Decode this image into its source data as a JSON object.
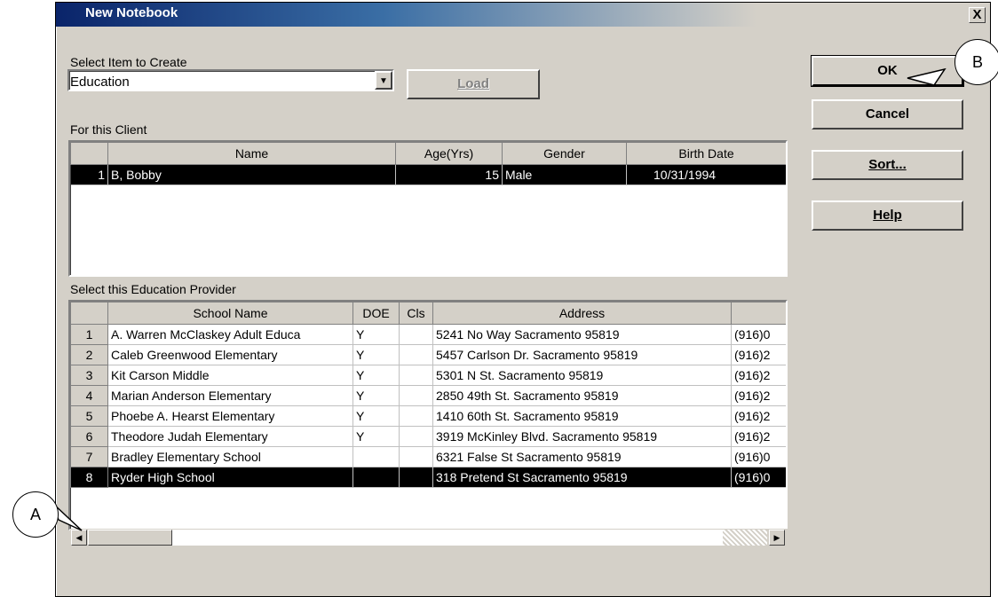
{
  "window": {
    "title": "New Notebook",
    "close_glyph": "X"
  },
  "select_item": {
    "label": "Select Item to Create",
    "value": "Education",
    "load_button": "Load"
  },
  "buttons": {
    "ok": "OK",
    "cancel": "Cancel",
    "sort": "Sort...",
    "help": "Help"
  },
  "client": {
    "label": "For this Client",
    "columns": [
      "Name",
      "Age(Yrs)",
      "Gender",
      "Birth Date"
    ],
    "rows": [
      {
        "num": "1",
        "name": "B, Bobby",
        "age": "15",
        "gender": "Male",
        "birth": "10/31/1994"
      }
    ]
  },
  "provider": {
    "label": "Select this Education Provider",
    "columns": [
      "School Name",
      "DOE",
      "Cls",
      "Address",
      ""
    ],
    "rows": [
      {
        "num": "1",
        "school": "A. Warren McClaskey Adult Educa",
        "doe": "Y",
        "cls": "",
        "address": "5241 No Way Sacramento 95819",
        "phone": "(916)0"
      },
      {
        "num": "2",
        "school": "Caleb Greenwood Elementary",
        "doe": "Y",
        "cls": "",
        "address": "5457 Carlson Dr. Sacramento 95819",
        "phone": "(916)2"
      },
      {
        "num": "3",
        "school": "Kit Carson Middle",
        "doe": "Y",
        "cls": "",
        "address": "5301 N St. Sacramento 95819",
        "phone": "(916)2"
      },
      {
        "num": "4",
        "school": "Marian Anderson Elementary",
        "doe": "Y",
        "cls": "",
        "address": "2850 49th St. Sacramento 95819",
        "phone": "(916)2"
      },
      {
        "num": "5",
        "school": "Phoebe A. Hearst Elementary",
        "doe": "Y",
        "cls": "",
        "address": "1410 60th St. Sacramento 95819",
        "phone": "(916)2"
      },
      {
        "num": "6",
        "school": "Theodore Judah Elementary",
        "doe": "Y",
        "cls": "",
        "address": "3919 McKinley Blvd. Sacramento 95819",
        "phone": "(916)2"
      },
      {
        "num": "7",
        "school": "Bradley Elementary School",
        "doe": "",
        "cls": "",
        "address": "6321 False St Sacramento 95819",
        "phone": "(916)0"
      },
      {
        "num": "8",
        "school": "Ryder High School",
        "doe": "",
        "cls": "",
        "address": "318 Pretend St Sacramento 95819",
        "phone": "(916)0"
      }
    ],
    "selected_row": 8
  },
  "callouts": {
    "a": "A",
    "b": "B"
  }
}
